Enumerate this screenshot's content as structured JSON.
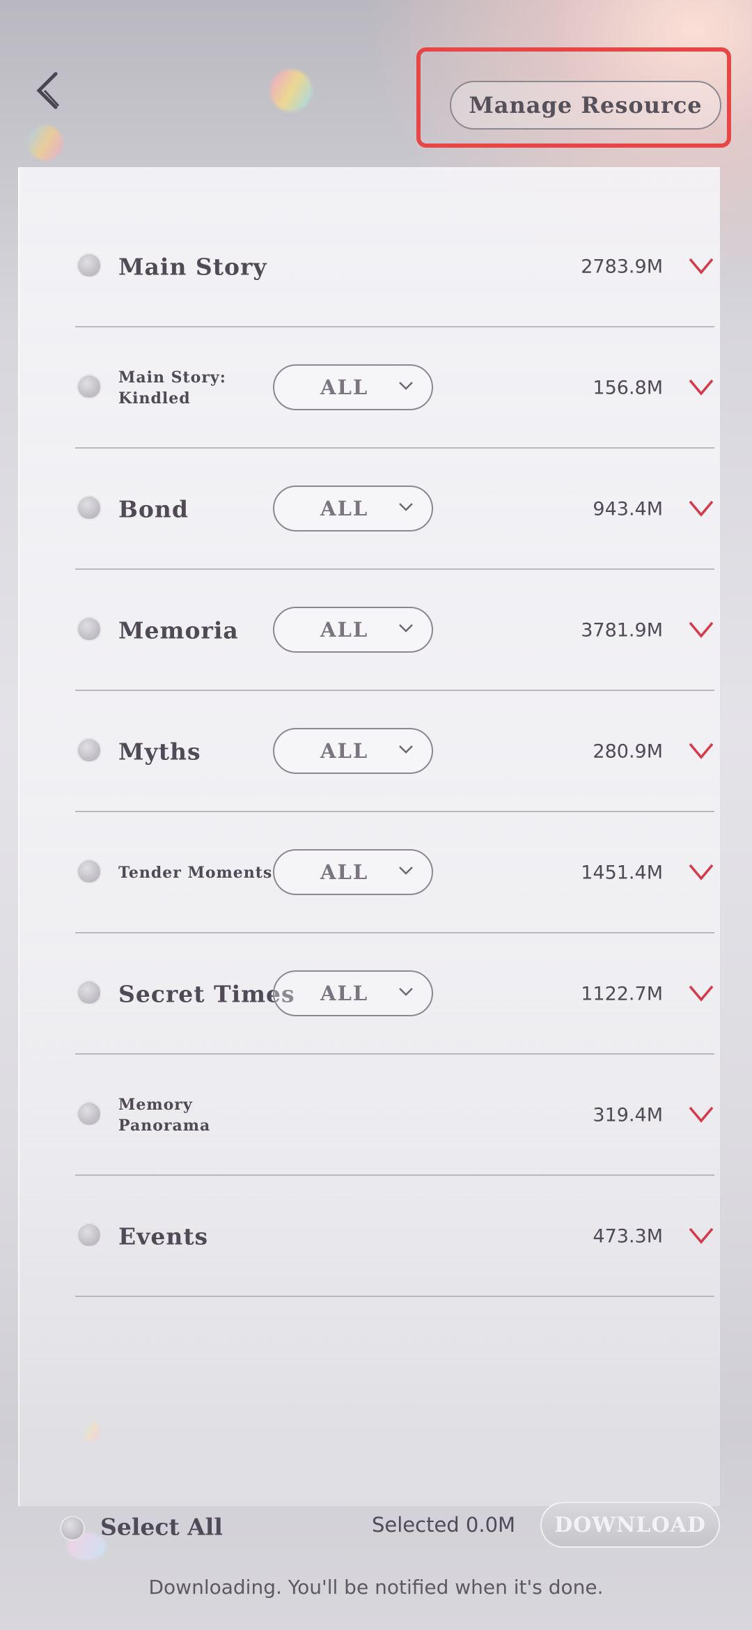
{
  "header": {
    "manage_label": "Manage Resource"
  },
  "colors": {
    "accent_red": "#d43a4a",
    "highlight_box": "#e64646",
    "text_dark": "#4f4a55"
  },
  "rows": [
    {
      "label": "Main Story",
      "dropdown": null,
      "size": "2783.9M"
    },
    {
      "label": "Main Story:\nKindled",
      "dropdown": "ALL",
      "size": "156.8M"
    },
    {
      "label": "Bond",
      "dropdown": "ALL",
      "size": "943.4M"
    },
    {
      "label": "Memoria",
      "dropdown": "ALL",
      "size": "3781.9M"
    },
    {
      "label": "Myths",
      "dropdown": "ALL",
      "size": "280.9M"
    },
    {
      "label": "Tender Moments",
      "dropdown": "ALL",
      "size": "1451.4M"
    },
    {
      "label": "Secret Times",
      "dropdown": "ALL",
      "size": "1122.7M"
    },
    {
      "label": "Memory\nPanorama",
      "dropdown": null,
      "size": "319.4M"
    },
    {
      "label": "Events",
      "dropdown": null,
      "size": "473.3M"
    }
  ],
  "footer": {
    "select_all_label": "Select All",
    "selected_text": "Selected 0.0M",
    "download_label": "DOWNLOAD",
    "notice": "Downloading. You'll be notified when it's done."
  },
  "icons": {
    "back": "chevron-left-icon",
    "expand": "chevron-down-icon",
    "dropdown": "chevron-down-icon"
  }
}
